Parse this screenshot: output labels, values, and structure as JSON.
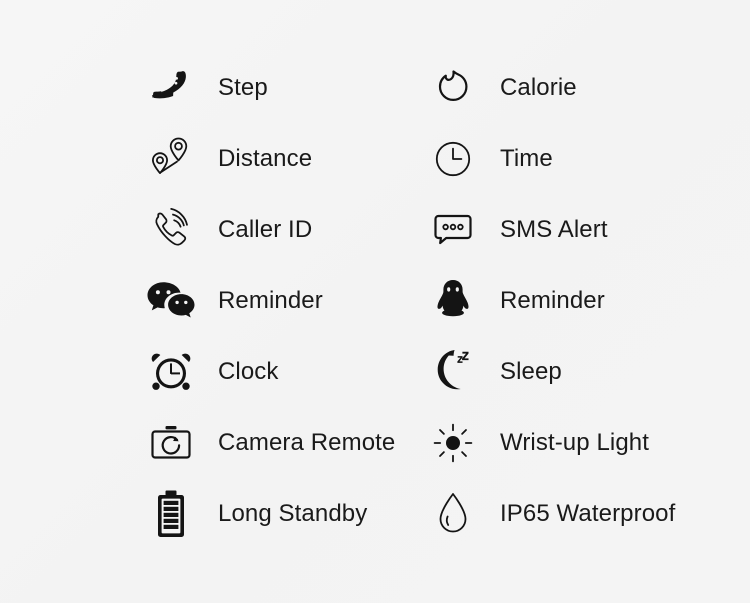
{
  "page": {
    "background_color": "#f4f4f4",
    "text_color": "#1a1a1a",
    "icon_color": "#141414",
    "columns": 2,
    "rows": 7
  },
  "features": [
    {
      "icon": "shoe-icon",
      "label": "Step",
      "column": "left",
      "row": 1
    },
    {
      "icon": "flame-icon",
      "label": "Calorie",
      "column": "right",
      "row": 1
    },
    {
      "icon": "map-pins-icon",
      "label": "Distance",
      "column": "left",
      "row": 2
    },
    {
      "icon": "clock-outline-icon",
      "label": "Time",
      "column": "right",
      "row": 2
    },
    {
      "icon": "phone-ring-icon",
      "label": "Caller ID",
      "column": "left",
      "row": 3
    },
    {
      "icon": "sms-bubble-icon",
      "label": "SMS Alert",
      "column": "right",
      "row": 3
    },
    {
      "icon": "wechat-icon",
      "label": "Reminder",
      "column": "left",
      "row": 4
    },
    {
      "icon": "qq-penguin-icon",
      "label": "Reminder",
      "column": "right",
      "row": 4
    },
    {
      "icon": "alarm-clock-icon",
      "label": "Clock",
      "column": "left",
      "row": 5
    },
    {
      "icon": "moon-sleep-icon",
      "label": "Sleep",
      "column": "right",
      "row": 5
    },
    {
      "icon": "camera-remote-icon",
      "label": "Camera Remote",
      "column": "left",
      "row": 6
    },
    {
      "icon": "sun-icon",
      "label": "Wrist-up Light",
      "column": "right",
      "row": 6
    },
    {
      "icon": "battery-icon",
      "label": "Long Standby",
      "column": "left",
      "row": 7
    },
    {
      "icon": "water-drop-icon",
      "label": "IP65 Waterproof",
      "column": "right",
      "row": 7
    }
  ]
}
